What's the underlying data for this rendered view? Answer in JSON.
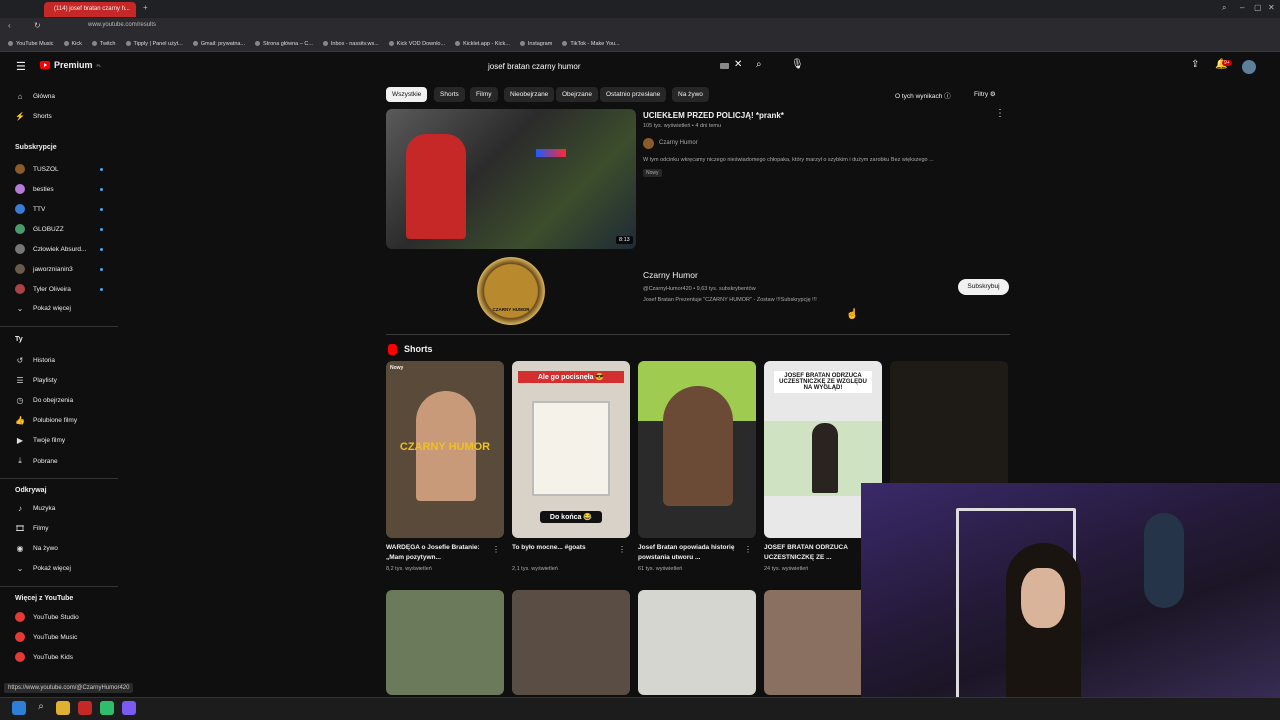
{
  "browser": {
    "tab_title": "(114) josef bratan czarny h...",
    "url": "www.youtube.com/results",
    "bookmarks": [
      "YouTube Music",
      "Kick",
      "Twitch",
      "Tipply | Panel użyt...",
      "Gmail: prywatna...",
      "Strona główna – C...",
      "Inbox - nassitv.ws...",
      "Kick VOD Downlo...",
      "Kicklet.app - Kick...",
      "Instagram",
      "TikTok - Make You..."
    ]
  },
  "header": {
    "logo_text": "Premium",
    "logo_sup": "PL",
    "search_query": "josef bratan czarny humor",
    "notifications_badge": "9+"
  },
  "sidebar": {
    "main": [
      {
        "label": "Główna",
        "icon": "home-icon"
      },
      {
        "label": "Shorts",
        "icon": "shorts-icon"
      }
    ],
    "subscriptions_title": "Subskrypcje",
    "subscriptions": [
      {
        "label": "TUSZOL",
        "color": "#8a5a2b"
      },
      {
        "label": "besties",
        "color": "#b57bd6"
      },
      {
        "label": "TTV",
        "color": "#3a7bd5"
      },
      {
        "label": "GLOBUZZ",
        "color": "#4a9a6a"
      },
      {
        "label": "Człowiek Absurd...",
        "color": "#777777"
      },
      {
        "label": "jaworznianin3",
        "color": "#6a5a4a"
      },
      {
        "label": "Tyler Oliveira",
        "color": "#aa4444"
      }
    ],
    "show_more": "Pokaż więcej",
    "you_title": "Ty",
    "you": [
      {
        "label": "Historia",
        "icon": "history-icon"
      },
      {
        "label": "Playlisty",
        "icon": "playlist-icon"
      },
      {
        "label": "Do obejrzenia",
        "icon": "watch-later-icon"
      },
      {
        "label": "Polubione filmy",
        "icon": "like-icon"
      },
      {
        "label": "Twoje filmy",
        "icon": "your-videos-icon"
      },
      {
        "label": "Pobrane",
        "icon": "download-icon"
      }
    ],
    "explore_title": "Odkrywaj",
    "explore": [
      {
        "label": "Muzyka",
        "icon": "music-icon"
      },
      {
        "label": "Filmy",
        "icon": "movies-icon"
      },
      {
        "label": "Na żywo",
        "icon": "live-icon"
      },
      {
        "label": "Pokaż więcej",
        "icon": "chevron-down-icon"
      }
    ],
    "more_title": "Więcej z YouTube",
    "more": [
      {
        "label": "YouTube Studio"
      },
      {
        "label": "YouTube Music"
      },
      {
        "label": "YouTube Kids"
      }
    ]
  },
  "chips": [
    "Wszystkie",
    "Shorts",
    "Filmy",
    "Nieobejrzane",
    "Obejrzane",
    "Ostatnio przesłane",
    "Na żywo"
  ],
  "results_info": "O tych wynikach",
  "filters": "Filtry",
  "video": {
    "title": "UCIEKŁEM PRZED POLICJĄ! *prank*",
    "meta": "105 tys. wyświetleń • 4 dni temu",
    "channel": "Czarny Humor",
    "description": "W tym odcinku wkręcamy niczego nieświadomego chłopaka, który marzył o szybkim i dużym zarobku Bez większego ...",
    "badge": "Nowy",
    "duration": "8:13"
  },
  "channel": {
    "name": "Czarny Humor",
    "handle_subs": "@CzarnyHumor420 • 9,63 tys. subskrybentów",
    "description": "Josef Bratan Prezentuje \"CZARNY HUMOR\" - Zostaw !!!Subskrypcję !!!",
    "subscribe_label": "Subskrybuj",
    "logo_text": "CZARNY HUMOR"
  },
  "shorts_title": "Shorts",
  "shorts": [
    {
      "title": "WARDĘGA o Josefie Bratanie: „Mam pozytywn...",
      "views": "8,2 tys. wyświetleń",
      "badge": "Nowy",
      "overlay": "CZARNY HUMOR",
      "color": "#5a4a3a"
    },
    {
      "title": "To było mocne... #goats",
      "views": "2,1 tys. wyświetleń",
      "badge": "",
      "overlay": "Ale go pocisnęła 😎",
      "overlay2": "Do końca 😂",
      "color": "#d8d2c8"
    },
    {
      "title": "Josef Bratan opowiada historię powstania utworu ...",
      "views": "61 tys. wyświetleń",
      "badge": "",
      "overlay": "",
      "color": "#2a2a2a"
    },
    {
      "title": "JOSEF BRATAN ODRZUCA UCZESTNICZKĘ ZE ...",
      "views": "24 tys. wyświetleń",
      "badge": "",
      "overlay": "JOSEF BRATAN ODRZUCA UCZESTNICZKĘ ZE WZGLĘDU NA WYGLĄD!",
      "color": "#e8e8e8"
    },
    {
      "title": "",
      "views": "",
      "badge": "",
      "overlay": "",
      "color": "#1e1a16"
    }
  ],
  "status_url": "https://www.youtube.com/@CzarnyHumor420"
}
